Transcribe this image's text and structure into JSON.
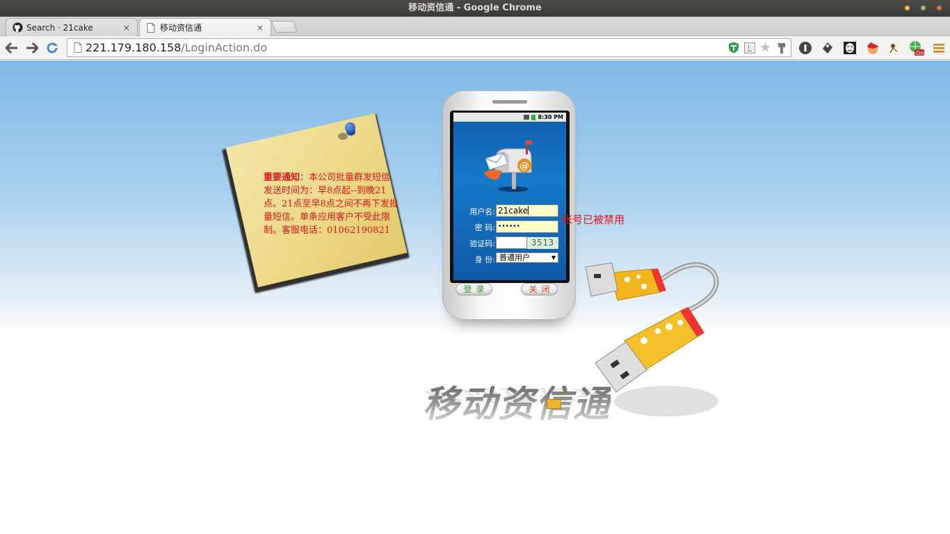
{
  "window": {
    "title": "移动资信通 - Google Chrome",
    "controls": {
      "colors": [
        "#f4b64d",
        "#8cc152",
        "#e06c4b"
      ]
    }
  },
  "tabs": [
    {
      "title": "Search · 21cake",
      "icon": "github-icon",
      "close": "×"
    },
    {
      "title": "移动资信通",
      "icon": "page-icon",
      "close": "×"
    }
  ],
  "toolbar": {
    "back": "←",
    "forward": "→",
    "reload": "↻",
    "url_host": "221.179.180.158",
    "url_path": "/LoginAction.do"
  },
  "notice": {
    "heading": "重要通知",
    "body": "：本公司批量群发短信发送时间为：早8点起--到晚21点。21点至早8点之间不再下发批量短信。单条应用客户不受此限制。客服电话：01062190821"
  },
  "phone": {
    "status_time": "8:30 PM",
    "form": {
      "username_label": "用户名:",
      "username_value": "21cake",
      "password_label": "密 码:",
      "password_value": "••••••",
      "captcha_label": "验证码:",
      "captcha_code": "3513",
      "role_label": "身 份:",
      "role_value": "普通用户"
    },
    "login_button": "登录",
    "close_button": "关闭"
  },
  "error": "帐号已被禁用",
  "logo": "移动资信通",
  "colors": {
    "error_red": "#e0141e",
    "input_bg": "#ffffc8",
    "screen_blue": "#1679c9"
  }
}
